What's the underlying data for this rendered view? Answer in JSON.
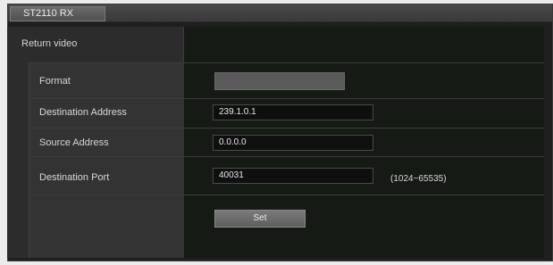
{
  "window": {
    "tab_title": "ST2110 RX"
  },
  "section": {
    "heading": "Return video"
  },
  "fields": {
    "format": {
      "label": "Format",
      "value": ""
    },
    "destination_address": {
      "label": "Destination Address",
      "value": "239.1.0.1"
    },
    "source_address": {
      "label": "Source Address",
      "value": "0.0.0.0"
    },
    "destination_port": {
      "label": "Destination Port",
      "value": "40031",
      "range_note": "(1024~65535)"
    }
  },
  "buttons": {
    "set_label": "Set"
  }
}
